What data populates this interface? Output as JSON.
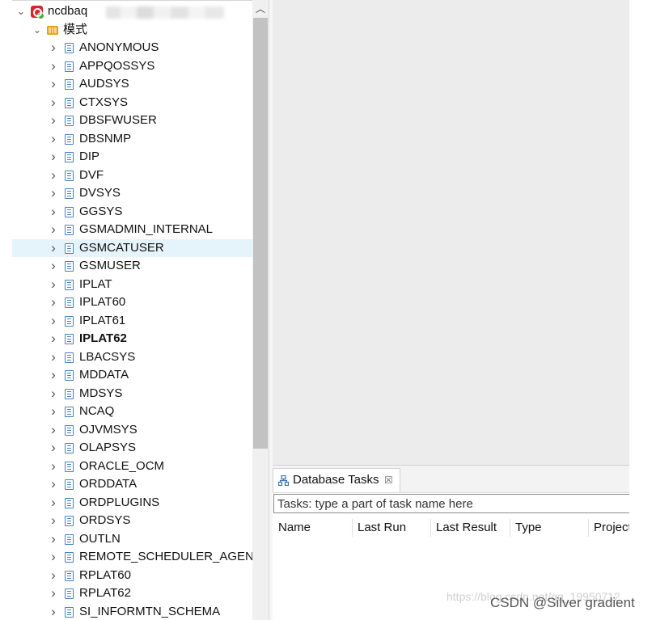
{
  "tree": {
    "connection": {
      "label": "ncdbaq",
      "icon": "database-connection-icon"
    },
    "folder": {
      "label": "模式",
      "icon": "schema-folder-icon"
    },
    "schemas": [
      {
        "label": "ANONYMOUS"
      },
      {
        "label": "APPQOSSYS"
      },
      {
        "label": "AUDSYS"
      },
      {
        "label": "CTXSYS"
      },
      {
        "label": "DBSFWUSER"
      },
      {
        "label": "DBSNMP"
      },
      {
        "label": "DIP"
      },
      {
        "label": "DVF"
      },
      {
        "label": "DVSYS"
      },
      {
        "label": "GGSYS"
      },
      {
        "label": "GSMADMIN_INTERNAL"
      },
      {
        "label": "GSMCATUSER",
        "selected": true
      },
      {
        "label": "GSMUSER"
      },
      {
        "label": "IPLAT"
      },
      {
        "label": "IPLAT60"
      },
      {
        "label": "IPLAT61"
      },
      {
        "label": "IPLAT62",
        "bold": true
      },
      {
        "label": "LBACSYS"
      },
      {
        "label": "MDDATA"
      },
      {
        "label": "MDSYS"
      },
      {
        "label": "NCAQ"
      },
      {
        "label": "OJVMSYS"
      },
      {
        "label": "OLAPSYS"
      },
      {
        "label": "ORACLE_OCM"
      },
      {
        "label": "ORDDATA"
      },
      {
        "label": "ORDPLUGINS"
      },
      {
        "label": "ORDSYS"
      },
      {
        "label": "OUTLN"
      },
      {
        "label": "REMOTE_SCHEDULER_AGENT"
      },
      {
        "label": "RPLAT60"
      },
      {
        "label": "RPLAT62"
      },
      {
        "label": "SI_INFORMTN_SCHEMA"
      }
    ]
  },
  "tasks_panel": {
    "tab_label": "Database Tasks",
    "tab_close": "☒",
    "filter_placeholder": "Tasks: type a part of task name here",
    "columns": [
      "Name",
      "Last Run",
      "Last Result",
      "Type",
      "Project"
    ]
  },
  "overlay": {
    "watermark": "https://blog.csdn.net/qq_19950712",
    "credit": "CSDN @Silver gradient"
  },
  "colors": {
    "selection": "#e5f3fb",
    "schema_icon": "#4d7fbc",
    "connection_icon": "#d9262a",
    "folder_icon": "#e8a317",
    "scroll_thumb": "#c2c2c2"
  }
}
